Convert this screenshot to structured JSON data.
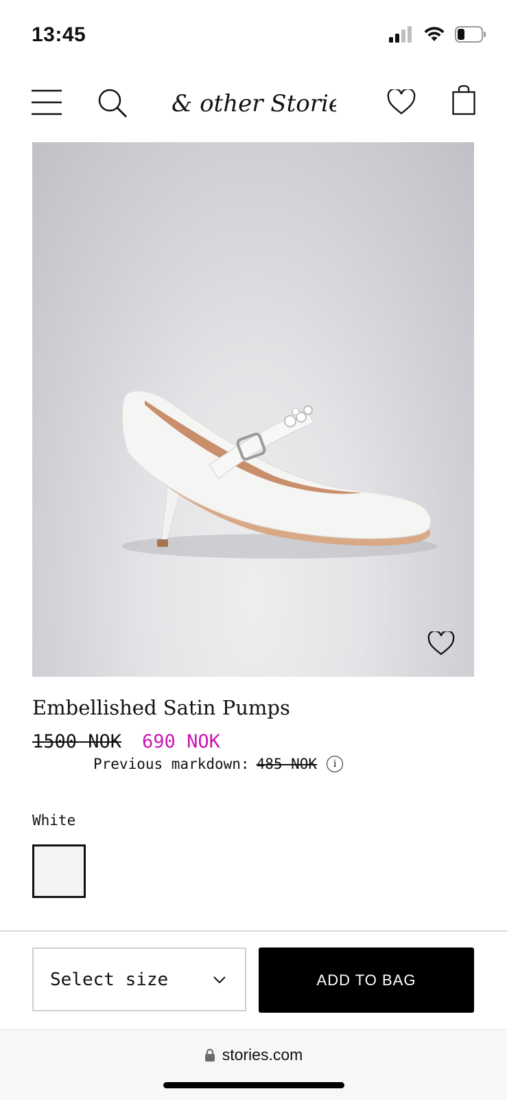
{
  "status_bar": {
    "time": "13:45"
  },
  "header": {
    "brand": "& other Stories"
  },
  "product": {
    "title": "Embellished Satin Pumps",
    "price_original": "1500 NOK",
    "price_sale": "690 NOK",
    "markdown_label": "Previous markdown:",
    "markdown_price": "485 NOK",
    "info_symbol": "i",
    "color_label": "White",
    "swatch_color": "#f3f3f1"
  },
  "actions": {
    "size_placeholder": "Select size",
    "add_to_bag": "ADD TO BAG"
  },
  "browser": {
    "url": "stories.com"
  },
  "colors": {
    "sale": "#cc14b4",
    "button": "#000000"
  }
}
